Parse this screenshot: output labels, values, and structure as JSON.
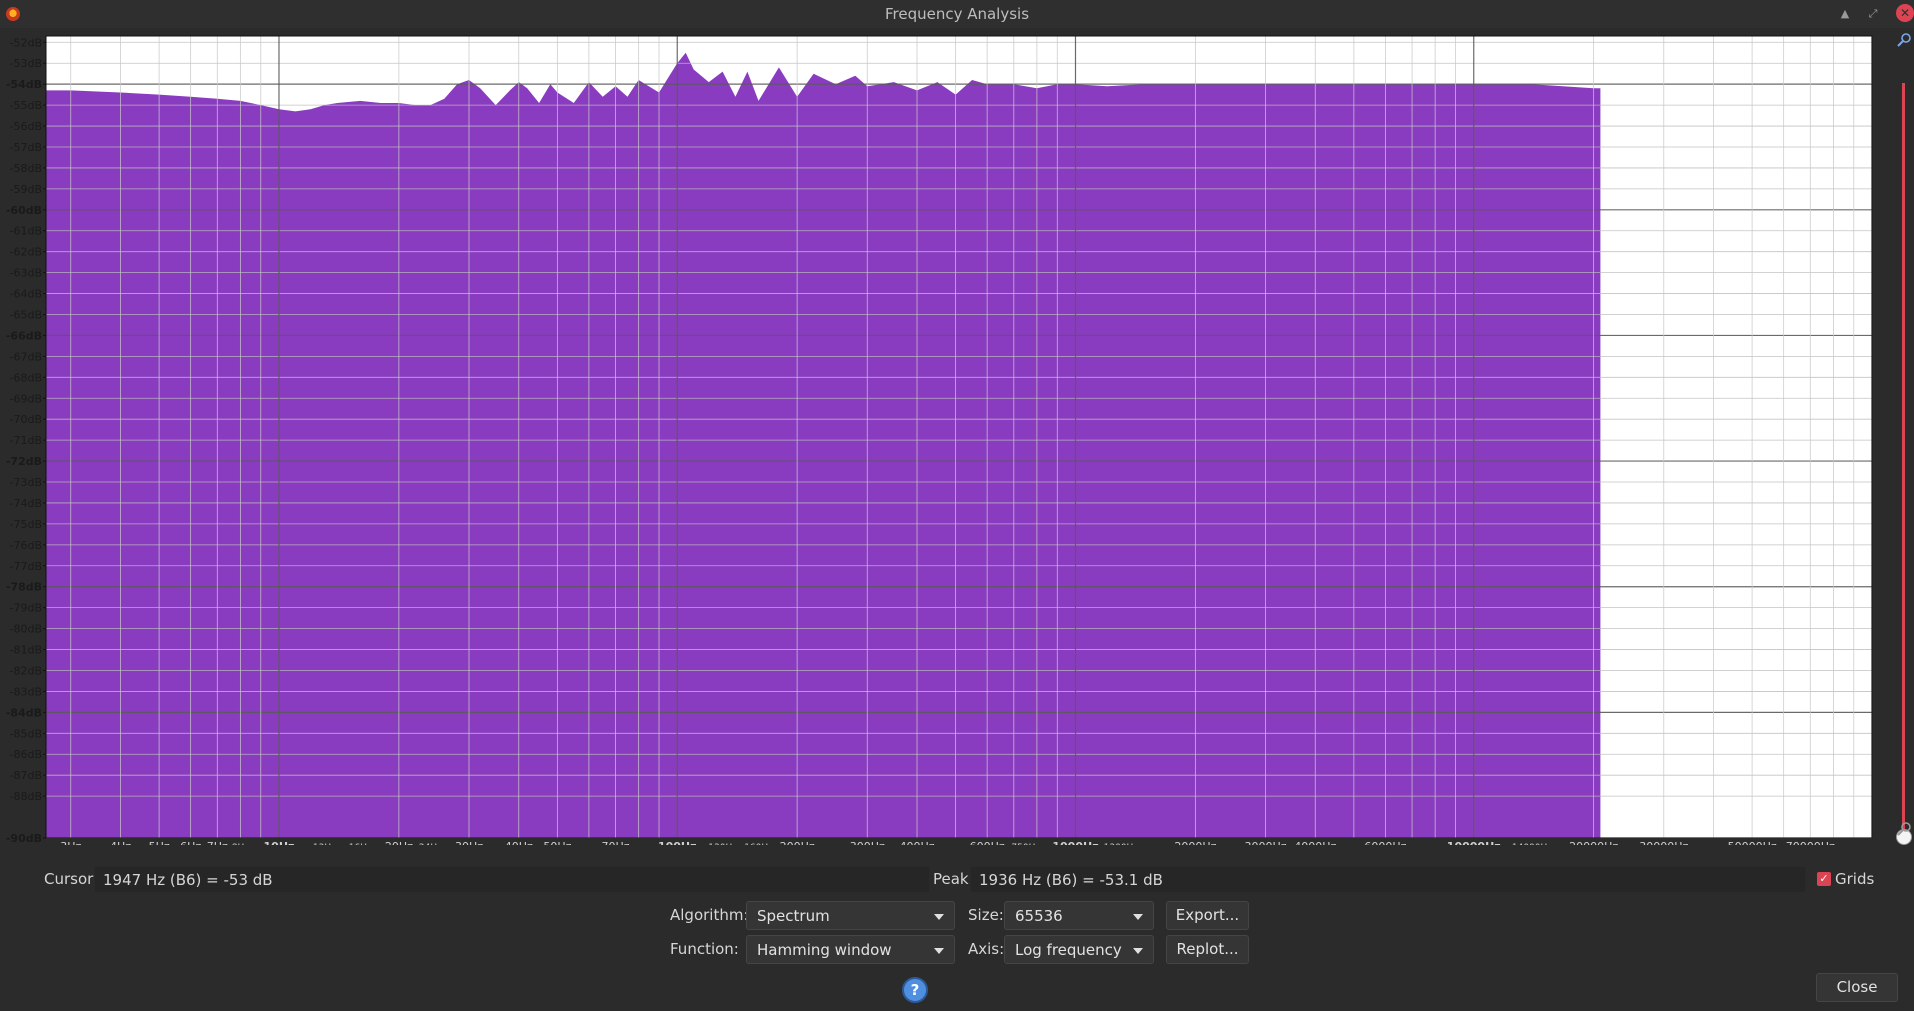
{
  "window": {
    "title": "Frequency Analysis"
  },
  "chart_data": {
    "type": "area",
    "title": "",
    "xlabel": "",
    "ylabel": "",
    "x_scale": "log",
    "xlim": [
      2.6,
      100000
    ],
    "ylim": [
      -90,
      -51.7
    ],
    "fill_color": "#8a3cc0",
    "grid": true,
    "y_ticks": [
      "-52dB",
      "-53dB",
      "-54dB",
      "-55dB",
      "-56dB",
      "-57dB",
      "-58dB",
      "-59dB",
      "-60dB",
      "-61dB",
      "-62dB",
      "-63dB",
      "-64dB",
      "-65dB",
      "-66dB",
      "-67dB",
      "-68dB",
      "-69dB",
      "-70dB",
      "-71dB",
      "-72dB",
      "-73dB",
      "-74dB",
      "-75dB",
      "-76dB",
      "-77dB",
      "-78dB",
      "-79dB",
      "-80dB",
      "-81dB",
      "-82dB",
      "-83dB",
      "-84dB",
      "-85dB",
      "-86dB",
      "-87dB",
      "-88dB",
      "-90dB"
    ],
    "y_tick_values": [
      -52,
      -53,
      -54,
      -55,
      -56,
      -57,
      -58,
      -59,
      -60,
      -61,
      -62,
      -63,
      -64,
      -65,
      -66,
      -67,
      -68,
      -69,
      -70,
      -71,
      -72,
      -73,
      -74,
      -75,
      -76,
      -77,
      -78,
      -79,
      -80,
      -81,
      -82,
      -83,
      -84,
      -85,
      -86,
      -87,
      -88,
      -90
    ],
    "y_major": [
      -54,
      -60,
      -66,
      -72,
      -78,
      -84,
      -90
    ],
    "x_ticks": [
      {
        "value": 3,
        "label": "3Hz"
      },
      {
        "value": 4,
        "label": "4Hz"
      },
      {
        "value": 5,
        "label": "5Hz"
      },
      {
        "value": 6,
        "label": "6Hz"
      },
      {
        "value": 7,
        "label": "7Hz"
      },
      {
        "value": 8,
        "label": "8Hz"
      },
      {
        "value": 10,
        "label": "10Hz",
        "major": true
      },
      {
        "value": 13,
        "label": "13Hz"
      },
      {
        "value": 16,
        "label": "16Hz"
      },
      {
        "value": 20,
        "label": "20Hz"
      },
      {
        "value": 24,
        "label": "24Hz"
      },
      {
        "value": 30,
        "label": "30Hz"
      },
      {
        "value": 40,
        "label": "40Hz"
      },
      {
        "value": 50,
        "label": "50Hz"
      },
      {
        "value": 70,
        "label": "70Hz"
      },
      {
        "value": 100,
        "label": "100Hz",
        "major": true
      },
      {
        "value": 130,
        "label": "130Hz"
      },
      {
        "value": 160,
        "label": "160Hz"
      },
      {
        "value": 200,
        "label": "200Hz"
      },
      {
        "value": 300,
        "label": "300Hz"
      },
      {
        "value": 400,
        "label": "400Hz"
      },
      {
        "value": 600,
        "label": "600Hz"
      },
      {
        "value": 750,
        "label": "750Hz"
      },
      {
        "value": 1000,
        "label": "1000Hz",
        "major": true
      },
      {
        "value": 1300,
        "label": "1300Hz"
      },
      {
        "value": 2000,
        "label": "2000Hz"
      },
      {
        "value": 3000,
        "label": "3000Hz"
      },
      {
        "value": 4000,
        "label": "4000Hz"
      },
      {
        "value": 6000,
        "label": "6000Hz"
      },
      {
        "value": 10000,
        "label": "10000Hz",
        "major": true
      },
      {
        "value": 14000,
        "label": "14000Hz"
      },
      {
        "value": 20000,
        "label": "20000Hz"
      },
      {
        "value": 30000,
        "label": "30000Hz"
      },
      {
        "value": 50000,
        "label": "50000Hz"
      },
      {
        "value": 70000,
        "label": "70000Hz"
      }
    ],
    "series": [
      {
        "x": [
          2.6,
          3,
          4,
          5,
          6,
          7,
          8,
          9,
          10,
          11,
          12,
          13,
          14,
          16,
          18,
          20,
          22,
          24,
          26,
          28,
          30,
          32,
          35,
          38,
          40,
          42,
          45,
          48,
          50,
          55,
          60,
          65,
          70,
          75,
          80,
          90,
          100,
          105,
          110,
          120,
          130,
          140,
          150,
          160,
          180,
          200,
          220,
          250,
          280,
          300,
          350,
          400,
          450,
          500,
          550,
          600,
          700,
          800,
          900,
          1000,
          1200,
          1500,
          2000,
          3000,
          4000,
          6000,
          8000,
          10000,
          14000,
          20000,
          20800
        ],
        "y": [
          -54.3,
          -54.3,
          -54.4,
          -54.5,
          -54.6,
          -54.7,
          -54.8,
          -55.0,
          -55.2,
          -55.3,
          -55.2,
          -55.0,
          -54.9,
          -54.8,
          -54.9,
          -54.9,
          -55.0,
          -55.0,
          -54.7,
          -54.0,
          -53.8,
          -54.2,
          -55.0,
          -54.3,
          -53.9,
          -54.2,
          -54.9,
          -54.0,
          -54.4,
          -54.9,
          -53.9,
          -54.6,
          -54.1,
          -54.6,
          -53.8,
          -54.4,
          -53.0,
          -52.5,
          -53.3,
          -53.9,
          -53.4,
          -54.6,
          -53.4,
          -54.8,
          -53.2,
          -54.6,
          -53.5,
          -54.0,
          -53.6,
          -54.1,
          -53.9,
          -54.3,
          -53.9,
          -54.5,
          -53.8,
          -54.0,
          -54.0,
          -54.2,
          -54.0,
          -54.0,
          -54.1,
          -54.0,
          -54.0,
          -54.0,
          -54.0,
          -54.0,
          -54.0,
          -54.0,
          -54.0,
          -54.2,
          -54.2
        ]
      }
    ]
  },
  "cursor": {
    "label": "Cursor:",
    "value": "1947 Hz (B6) = -53 dB"
  },
  "peak": {
    "label": "Peak:",
    "value": "1936 Hz (B6) = -53.1 dB"
  },
  "grids": {
    "label": "Grids",
    "checked": true
  },
  "algorithm": {
    "label": "Algorithm:",
    "value": "Spectrum"
  },
  "function": {
    "label": "Function:",
    "value": "Hamming window"
  },
  "size": {
    "label": "Size:",
    "value": "65536"
  },
  "axis": {
    "label": "Axis:",
    "value": "Log frequency"
  },
  "buttons": {
    "export": "Export...",
    "replot": "Replot...",
    "close": "Close",
    "help": "?"
  }
}
